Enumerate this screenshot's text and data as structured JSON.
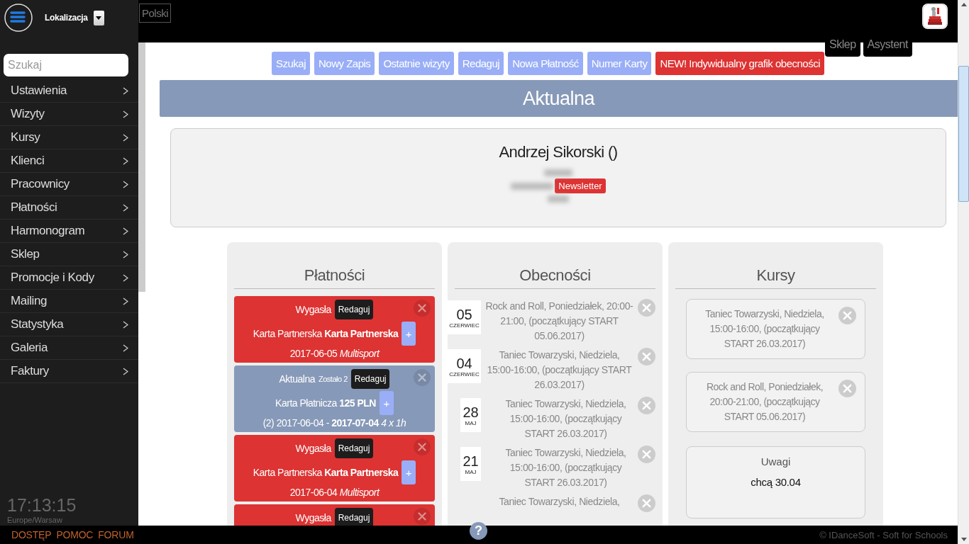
{
  "sidebar": {
    "location_label": "Lokalizacja",
    "search": {
      "placeholder": "Szukaj"
    },
    "items": [
      {
        "label": "Ustawienia"
      },
      {
        "label": "Wizyty"
      },
      {
        "label": "Kursy"
      },
      {
        "label": "Klienci"
      },
      {
        "label": "Pracownicy"
      },
      {
        "label": "Płatności"
      },
      {
        "label": "Harmonogram"
      },
      {
        "label": "Sklep"
      },
      {
        "label": "Promocje i Kody"
      },
      {
        "label": "Mailing"
      },
      {
        "label": "Statystyka"
      },
      {
        "label": "Galeria"
      },
      {
        "label": "Faktury"
      }
    ],
    "clock": {
      "time": "17:13:15",
      "zone": "Europe/Warsaw"
    }
  },
  "topbar": {
    "language": "Polski",
    "tabs": [
      {
        "label": "Sklep"
      },
      {
        "label": "Asystent"
      }
    ]
  },
  "actions": [
    {
      "label": "Szukaj",
      "kind": "normal"
    },
    {
      "label": "Nowy Zapis",
      "kind": "normal"
    },
    {
      "label": "Ostatnie wizyty",
      "kind": "normal"
    },
    {
      "label": "Redaguj",
      "kind": "normal"
    },
    {
      "label": "Nowa Płatność",
      "kind": "normal"
    },
    {
      "label": "Numer Karty",
      "kind": "normal"
    },
    {
      "label": "NEW! Indywidualny grafik obecności",
      "kind": "highlight"
    }
  ],
  "header": {
    "title": "Aktualna"
  },
  "client": {
    "name": "Andrzej Sikorski ()",
    "badge": "Newsletter"
  },
  "payments": {
    "title": "Płatności",
    "items": [
      {
        "kind": "expired",
        "status": "Wygasła",
        "edit": "Redaguj",
        "card": "Karta Partnerska **Karta Partnerska**",
        "add": "+",
        "dates": "2017-06-05 *Multisport*"
      },
      {
        "kind": "active",
        "status": "Aktualna",
        "note": "Zostało 2",
        "edit": "Redaguj",
        "card": "Karta Płatnicza **125 PLN**",
        "add": "+",
        "dates": "(2) 2017-06-04 - **2017-07-04** *4 x 1h*"
      },
      {
        "kind": "expired",
        "status": "Wygasła",
        "edit": "Redaguj",
        "card": "Karta Partnerska **Karta Partnerska**",
        "add": "+",
        "dates": "2017-06-04 *Multisport*"
      },
      {
        "kind": "expired",
        "status": "Wygasła",
        "edit": "Redaguj"
      }
    ]
  },
  "attendance": {
    "title": "Obecności",
    "items": [
      {
        "day": "05",
        "month": "CZERWIEC",
        "text": "Rock and Roll, Poniedziałek, 20:00-21:00, (początkujący START 05.06.2017)"
      },
      {
        "day": "04",
        "month": "CZERWIEC",
        "text": "Taniec Towarzyski, Niedziela, 15:00-16:00, (początkujący START 26.03.2017)"
      },
      {
        "day": "28",
        "month": "MAJ",
        "text": "Taniec Towarzyski, Niedziela, 15:00-16:00, (początkujący START 26.03.2017)"
      },
      {
        "day": "21",
        "month": "MAJ",
        "text": "Taniec Towarzyski, Niedziela, 15:00-16:00, (początkujący START 26.03.2017)"
      },
      {
        "text": "Taniec Towarzyski, Niedziela,"
      }
    ]
  },
  "courses": {
    "title": "Kursy",
    "items": [
      {
        "text": "Taniec Towarzyski, Niedziela, 15:00-16:00, (początkujący START 26.03.2017)"
      },
      {
        "text": "Rock and Roll, Poniedziałek, 20:00-21:00, (początkujący START 05.06.2017)"
      }
    ],
    "notes": {
      "title": "Uwagi",
      "text": "chcą 30.04"
    }
  },
  "footer": {
    "links": [
      "DOSTĘP",
      "POMOC",
      "FORUM"
    ],
    "help": "?",
    "copyright": "© IDanceSoft - Soft for Schools"
  }
}
